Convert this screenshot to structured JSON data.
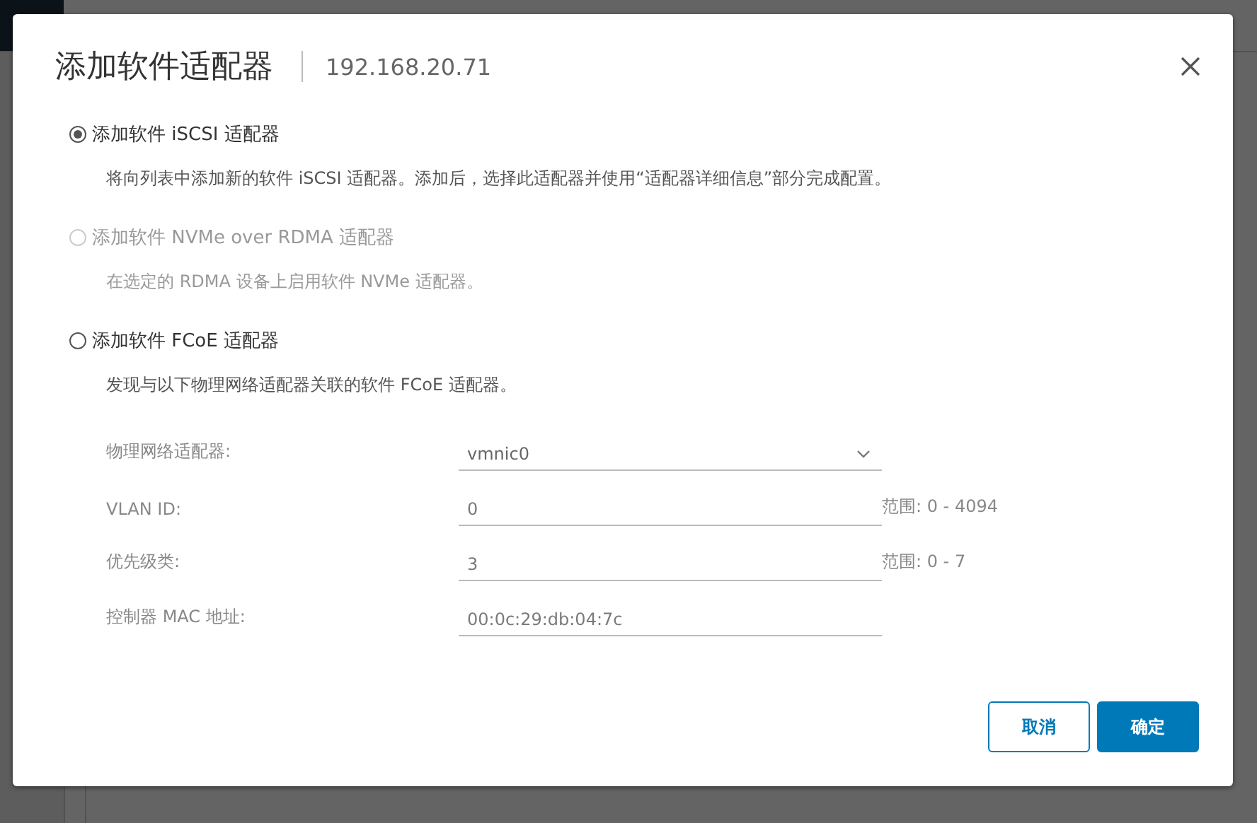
{
  "dialog": {
    "title": "添加软件适配器",
    "host": "192.168.20.71",
    "options": [
      {
        "label": "添加软件 iSCSI 适配器",
        "description": "将向列表中添加新的软件 iSCSI 适配器。添加后，选择此适配器并使用“适配器详细信息”部分完成配置。",
        "selected": true,
        "disabled": false
      },
      {
        "label": "添加软件 NVMe over RDMA 适配器",
        "description": "在选定的 RDMA 设备上启用软件 NVMe 适配器。",
        "selected": false,
        "disabled": true
      },
      {
        "label": "添加软件 FCoE 适配器",
        "description": "发现与以下物理网络适配器关联的软件 FCoE 适配器。",
        "selected": false,
        "disabled": false
      }
    ],
    "fields": [
      {
        "kind": "select",
        "label": "物理网络适配器:",
        "value": "vmnic0"
      },
      {
        "kind": "input",
        "label": "VLAN ID:",
        "value": "0",
        "hint": "范围: 0 - 4094"
      },
      {
        "kind": "input",
        "label": "优先级类:",
        "value": "3",
        "hint": "范围: 0 - 7"
      },
      {
        "kind": "input",
        "label": "控制器 MAC 地址:",
        "value": "00:0c:29:db:04:7c"
      }
    ],
    "buttons": [
      {
        "label": "取消",
        "kind": "secondary"
      },
      {
        "label": "确定",
        "kind": "primary"
      }
    ]
  }
}
